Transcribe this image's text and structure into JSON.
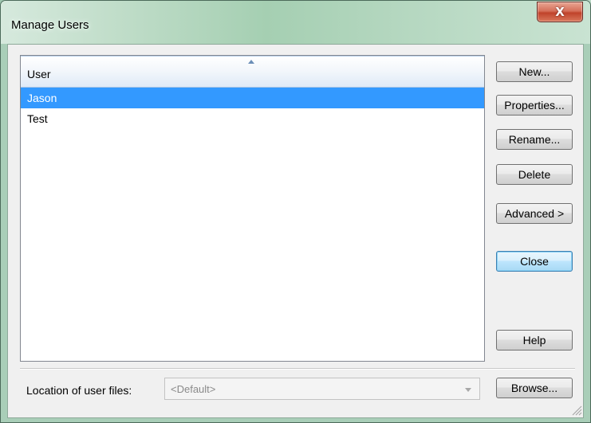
{
  "window": {
    "title": "Manage Users",
    "close_glyph": "X"
  },
  "user_list": {
    "column_header": "User",
    "sort_direction": "ascending",
    "rows": [
      {
        "label": "Jason",
        "selected": true
      },
      {
        "label": "Test",
        "selected": false
      }
    ]
  },
  "buttons": {
    "new": "New...",
    "properties": "Properties...",
    "rename": "Rename...",
    "delete": "Delete",
    "advanced": "Advanced >",
    "close": "Close",
    "help": "Help",
    "browse": "Browse..."
  },
  "location": {
    "label": "Location of user files:",
    "value": "<Default>"
  },
  "colors": {
    "selection": "#3399ff",
    "close_button": "#c0432b",
    "titlebar": "#a5cfb2"
  }
}
